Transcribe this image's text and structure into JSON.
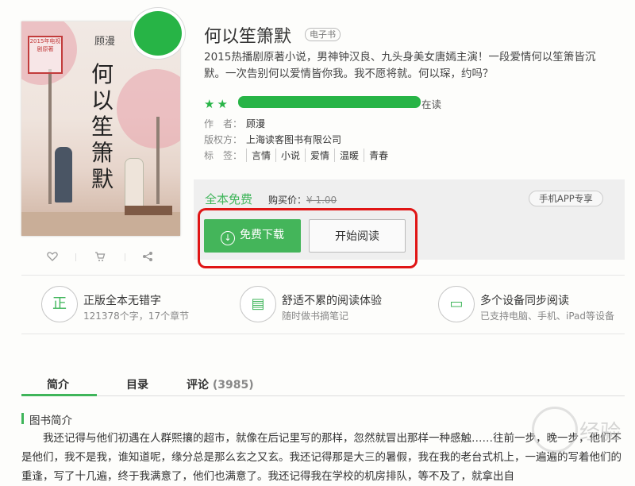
{
  "book": {
    "title": "何以笙箫默",
    "badge": "电子书",
    "description": "2015热播剧原著小说，男神钟汉良、九头身美女唐嫣主演！一段爱情何以笙箫皆沉默。一次告别何以爱情皆你我。我不愿将就。何以琛，约吗？",
    "reading_suffix": "在读",
    "author_key": "作　者：",
    "author": "顾漫",
    "copyright_key": "版权方：",
    "copyright": "上海读客图书有限公司",
    "tags_key": "标　签：",
    "tags": [
      "言情",
      "小说",
      "爱情",
      "温暖",
      "青春"
    ],
    "cover": {
      "author": "顾漫",
      "title": "何以笙箫默",
      "seal": "2015年电视剧原著"
    }
  },
  "cover_actions": {
    "like_icon": "heart-icon",
    "cart_icon": "cart-icon",
    "share_icon": "share-icon"
  },
  "purchase": {
    "free_label": "全本免费",
    "price_label": "购买价：",
    "price_value": "¥ 1.00",
    "app_exclusive": "手机APP专享",
    "download_button": "免费下载",
    "read_button": "开始阅读"
  },
  "features": [
    {
      "icon": "正",
      "title": "正版全本无错字",
      "sub": "121378个字，17个章节"
    },
    {
      "icon": "▤",
      "title": "舒适不累的阅读体验",
      "sub": "随时做书摘笔记"
    },
    {
      "icon": "▭",
      "title": "多个设备同步阅读",
      "sub": "已支持电脑、手机、iPad等设备"
    }
  ],
  "tabs": [
    {
      "label": "简介",
      "count": ""
    },
    {
      "label": "目录",
      "count": ""
    },
    {
      "label": "评论",
      "count": "(3985)"
    }
  ],
  "intro": {
    "title": "图书简介",
    "text": "我还记得与他们初遇在人群熙攘的超市，就像在后记里写的那样，忽然就冒出那样一种感触……往前一步，晚一步，他们不是他们，我不是我，谁知道呢，缘分总是那么玄之又玄。我还记得那是大三的暑假，我在我的老台式机上，一遍遍的写着他们的重逢，写了十几遍，终于我满意了，他们也满意了。我还记得我在学校的机房排队，等不及了，就拿出自"
  },
  "watermark": "经验",
  "colors": {
    "accent": "#3fb55a",
    "highlight": "#e01515"
  }
}
